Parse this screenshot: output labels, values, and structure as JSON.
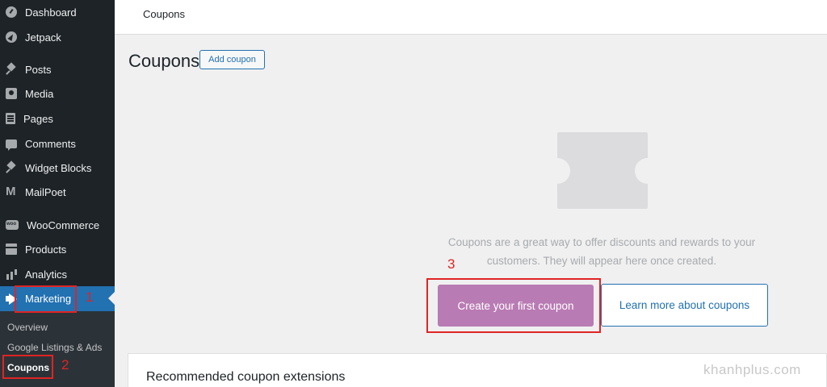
{
  "sidebar": {
    "items": [
      {
        "label": "Dashboard",
        "icon": "gauge-icon"
      },
      {
        "label": "Jetpack",
        "icon": "jetpack-icon"
      },
      {
        "label": "Posts",
        "icon": "pin-icon"
      },
      {
        "label": "Media",
        "icon": "media-icon"
      },
      {
        "label": "Pages",
        "icon": "pages-icon"
      },
      {
        "label": "Comments",
        "icon": "comment-icon"
      },
      {
        "label": "Widget Blocks",
        "icon": "pin-icon"
      },
      {
        "label": "MailPoet",
        "icon": "mailpoet-icon"
      },
      {
        "label": "WooCommerce",
        "icon": "woocommerce-icon"
      },
      {
        "label": "Products",
        "icon": "archive-icon"
      },
      {
        "label": "Analytics",
        "icon": "bar-chart-icon"
      },
      {
        "label": "Marketing",
        "icon": "megaphone-icon",
        "active": true
      }
    ],
    "submenu": [
      {
        "label": "Overview"
      },
      {
        "label": "Google Listings & Ads"
      },
      {
        "label": "Coupons",
        "current": true
      }
    ]
  },
  "topbar": {
    "breadcrumb": "Coupons"
  },
  "header": {
    "title": "Coupons",
    "add_button": "Add coupon"
  },
  "empty_state": {
    "icon": "ticket-icon",
    "text_line1": "Coupons are a great way to offer discounts and rewards to your",
    "text_line2": "customers. They will appear here once created.",
    "primary_button": "Create your first coupon",
    "secondary_button": "Learn more about coupons"
  },
  "recommended": {
    "title": "Recommended coupon extensions"
  },
  "annotations": {
    "n1": "1",
    "n2": "2",
    "n3": "3",
    "color": "#e02424"
  },
  "watermark": "khanhplus.com",
  "colors": {
    "sidebar": "#1d2327",
    "accent": "#2271b1",
    "primary_button": "#b97bb3"
  }
}
